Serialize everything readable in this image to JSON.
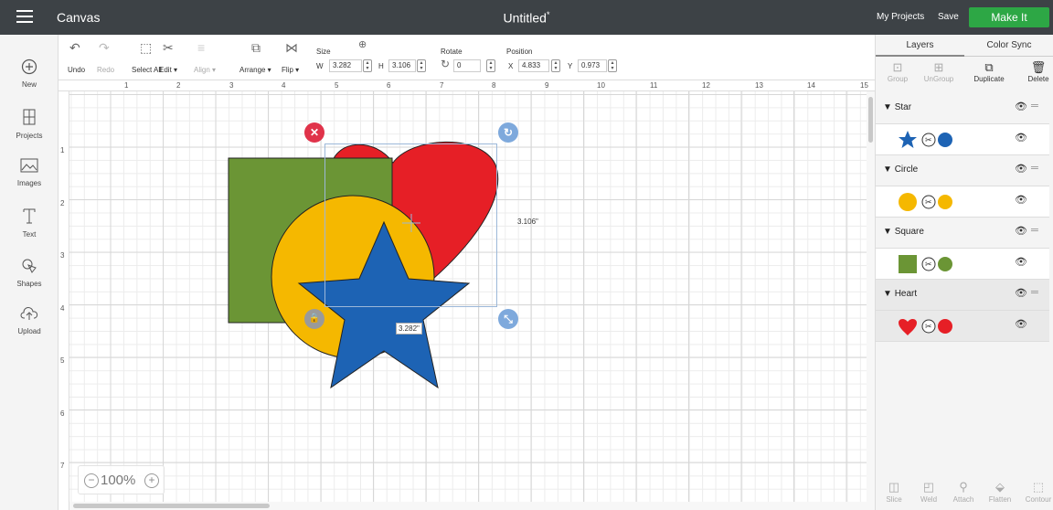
{
  "header": {
    "app_title": "Canvas",
    "doc_title": "Untitled",
    "unsaved_mark": "*",
    "my_projects": "My Projects",
    "save": "Save",
    "make_it": "Make It"
  },
  "sidebar": {
    "items": [
      {
        "label": "New",
        "icon": "plus-circle-icon"
      },
      {
        "label": "Projects",
        "icon": "projects-icon"
      },
      {
        "label": "Images",
        "icon": "image-icon"
      },
      {
        "label": "Text",
        "icon": "text-icon"
      },
      {
        "label": "Shapes",
        "icon": "shapes-icon"
      },
      {
        "label": "Upload",
        "icon": "upload-icon"
      }
    ]
  },
  "toolbar": {
    "undo": "Undo",
    "redo": "Redo",
    "select_all": "Select All",
    "edit": "Edit ▾",
    "align": "Align ▾",
    "arrange": "Arrange ▾",
    "flip": "Flip ▾",
    "size_label": "Size",
    "w_label": "W",
    "w_value": "3.282",
    "h_label": "H",
    "h_value": "3.106",
    "rotate_label": "Rotate",
    "rotate_value": "0",
    "position_label": "Position",
    "x_label": "X",
    "x_value": "4.833",
    "y_label": "Y",
    "y_value": "0.973"
  },
  "ruler": {
    "top": [
      "1",
      "2",
      "3",
      "4",
      "5",
      "6",
      "7",
      "8",
      "9",
      "10",
      "11",
      "12",
      "13",
      "14",
      "15"
    ],
    "left": [
      "1",
      "2",
      "3",
      "4",
      "5",
      "6",
      "7"
    ]
  },
  "canvas": {
    "height_dim": "3.106\"",
    "width_dim": "3.282\"",
    "zoom": "100%"
  },
  "colors": {
    "star": "#1d63b4",
    "circle": "#f5b800",
    "square": "#6b9535",
    "heart": "#e61f26",
    "make_it": "#2da745",
    "topbar": "#3d4246",
    "handle_delete": "#e0334a",
    "handle_blue": "#7ea9dc"
  },
  "right_panel": {
    "tabs": [
      "Layers",
      "Color Sync"
    ],
    "tools": [
      "Group",
      "UnGroup",
      "Duplicate",
      "Delete"
    ],
    "layers": [
      {
        "name": "Star"
      },
      {
        "name": "Circle"
      },
      {
        "name": "Square"
      },
      {
        "name": "Heart"
      }
    ],
    "footer": [
      "Slice",
      "Weld",
      "Attach",
      "Flatten",
      "Contour"
    ]
  }
}
